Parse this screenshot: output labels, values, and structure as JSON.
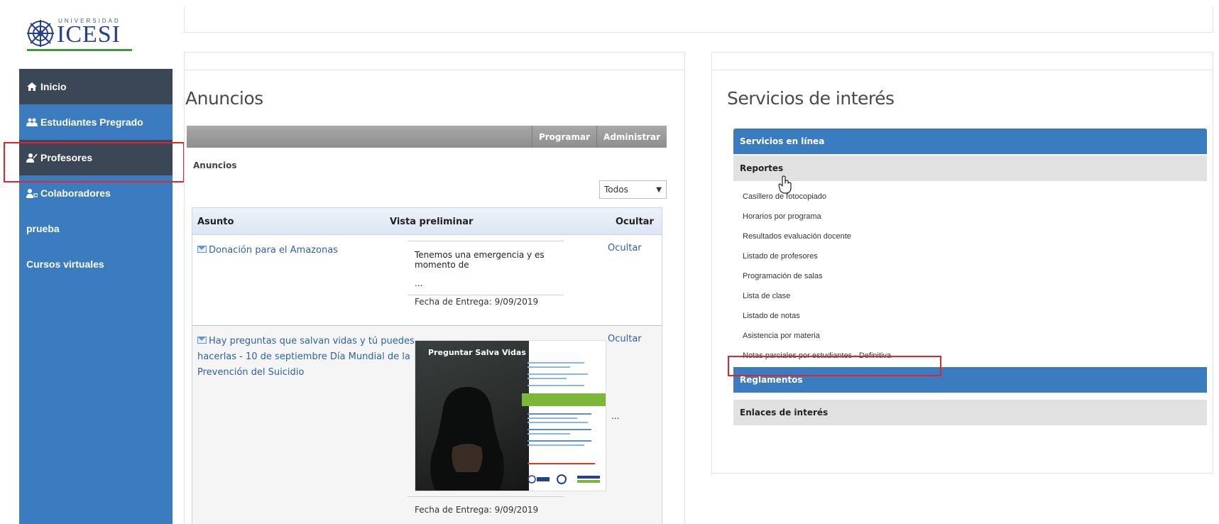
{
  "logo": {
    "university": "UNIVERSIDAD",
    "brand": "ICESI"
  },
  "sidebar": {
    "items": [
      {
        "label": "Inicio",
        "icon": "home-icon"
      },
      {
        "label": "Estudiantes Pregrado",
        "icon": "students-icon"
      },
      {
        "label": "Profesores",
        "icon": "teacher-icon"
      },
      {
        "label": "Colaboradores",
        "icon": "collaborators-icon"
      },
      {
        "label": "prueba"
      },
      {
        "label": "Cursos virtuales"
      }
    ]
  },
  "announcements": {
    "title": "Anuncios",
    "toolbar": {
      "program": "Programar",
      "admin": "Administrar"
    },
    "subtitle": "Anuncios",
    "filter": "Todos",
    "columns": [
      "Asunto",
      "Vista preliminar",
      "Ocultar"
    ],
    "rows": [
      {
        "subject": "Donación para el Amazonas",
        "preview": "Tenemos una emergencia y es momento de",
        "ellipsis": "...",
        "due": "Fecha de Entrega: 9/09/2019",
        "hide": "Ocultar"
      },
      {
        "subject_lines": [
          "Hay preguntas que salvan vidas y tú puedes",
          "hacerlas - 10 de septiembre Día Mundial de la",
          "Prevención del Suicidio"
        ],
        "poster_title": "Preguntar Salva Vidas",
        "ellipsis": "...",
        "due": "Fecha de Entrega: 9/09/2019",
        "hide": "Ocultar"
      }
    ]
  },
  "services": {
    "title": "Servicios de interés",
    "online": "Servicios en línea",
    "reports": "Reportes",
    "report_items": [
      "Casillero de fotocopiado",
      "Horarios por programa",
      "Resultados evaluación docente",
      "Listado de profesores",
      "Programación de salas",
      "Lista de clase",
      "Listado de notas",
      "Asistencia por materia",
      "Notas parciales por estudiantes - Definitiva"
    ],
    "regulations": "Reglamentos",
    "links": "Enlaces de interés"
  },
  "colors": {
    "sidebar": "#3b7bbf",
    "sidebar_active": "#3b4657",
    "highlight": "#e0242b",
    "link": "#2d62a8"
  }
}
